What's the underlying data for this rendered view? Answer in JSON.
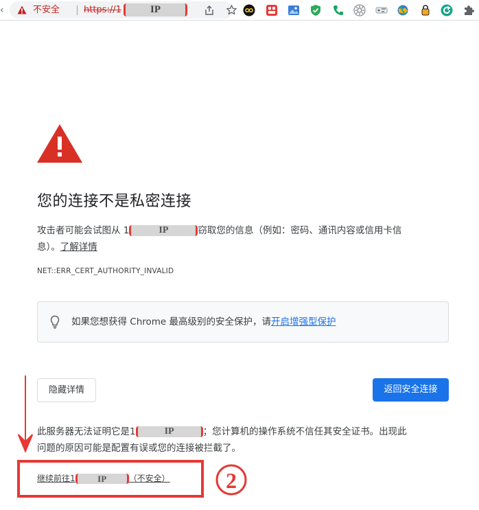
{
  "browser": {
    "security_label": "不安全",
    "url_prefix": "https://1",
    "url_redaction": "IP",
    "extensions": [
      {
        "icon": "infinity-icon",
        "color": "#111111"
      },
      {
        "icon": "red-app-icon",
        "color": "#e53935"
      },
      {
        "icon": "photo-icon",
        "color": "#3b7dd8"
      },
      {
        "icon": "shield-check-icon",
        "color": "#2eaa5c"
      },
      {
        "icon": "phone-icon",
        "color": "#1aa260"
      },
      {
        "icon": "gear-icon",
        "color": "#8a8f95"
      },
      {
        "icon": "tag-icon",
        "color": "#9aa0a6"
      },
      {
        "icon": "globe-icon",
        "color": "#e8a317"
      },
      {
        "icon": "lock-icon",
        "color": "#202124"
      },
      {
        "icon": "refresh-icon",
        "color": "#17a589"
      },
      {
        "icon": "puzzle-icon",
        "color": "#5f6368"
      }
    ]
  },
  "page": {
    "heading": "您的连接不是私密连接",
    "explain": {
      "before": "攻击者可能会试图从 1",
      "redaction": "IP",
      "after": "窃取您的信息（例如：密码、通讯内容或信用卡信",
      "line2_before": "息）。",
      "learn_more": "了解详情"
    },
    "error_code": "NET::ERR_CERT_AUTHORITY_INVALID",
    "enhanced": {
      "text": "如果您想获得 Chrome 最高级别的安全保护，请",
      "link": "开启增强型保护"
    },
    "hide_details_label": "隐藏详情",
    "back_to_safety_label": "返回安全连接",
    "details": {
      "before": "此服务器无法证明它是1",
      "redaction": "IP",
      "after": "；您计算机的操作系统不信任其安全证书。出现此",
      "line2": "问题的原因可能是配置有误或您的连接被拦截了。"
    },
    "proceed": {
      "before": "继续前往1",
      "redaction": "IP",
      "after": "（不安全）"
    }
  },
  "annotation": {
    "step_number": "②",
    "color": "#e53935"
  }
}
